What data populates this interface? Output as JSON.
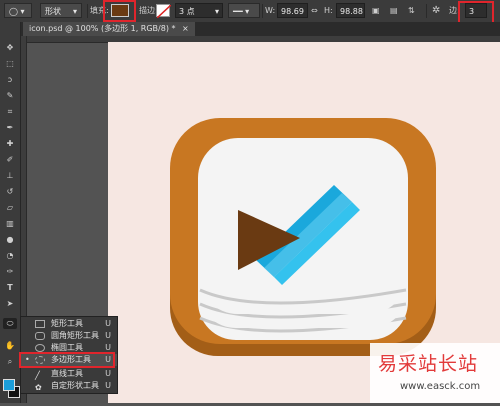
{
  "options": {
    "mode": "形状",
    "fill_label": "填充:",
    "stroke_label": "描边:",
    "stroke_width": "3 点",
    "w_label": "W:",
    "w_value": "98.69",
    "h_label": "H:",
    "h_value": "98.88",
    "sides_label": "边:",
    "sides_value": "3",
    "fill_color": "#6a3a12",
    "highlight_color": "#e0252c"
  },
  "document": {
    "tab_title": "icon.psd @ 100% (多边形 1, RGB/8) *"
  },
  "toolbar": {
    "tools": [
      "move-icon",
      "marquee-icon",
      "lasso-icon",
      "quick-select-icon",
      "crop-icon",
      "eyedropper-icon",
      "healing-icon",
      "brush-icon",
      "stamp-icon",
      "history-brush-icon",
      "eraser-icon",
      "gradient-icon",
      "blur-icon",
      "dodge-icon",
      "pen-icon",
      "type-icon",
      "path-select-icon",
      "shape-icon",
      "hand-icon",
      "zoom-icon"
    ],
    "foreground_color": "#1b9ed9",
    "background_color": "#111111"
  },
  "flyout": {
    "items": [
      {
        "label": "矩形工具",
        "key": "U"
      },
      {
        "label": "圆角矩形工具",
        "key": "U"
      },
      {
        "label": "椭圆工具",
        "key": "U"
      },
      {
        "label": "多边形工具",
        "key": "U"
      },
      {
        "label": "直线工具",
        "key": "U"
      },
      {
        "label": "自定形状工具",
        "key": "U"
      }
    ],
    "selected_index": 3
  },
  "icon_art": {
    "frame_color": "#c87722",
    "frame_shadow_color": "#a35e17",
    "card_color": "#f4f4f4",
    "card_edge_color": "#c9c9c9",
    "triangle_color": "#6a3a12",
    "stripe_colors": [
      "#1aa8dc",
      "#34c2ee",
      "#6fd6f5"
    ]
  },
  "watermark": {
    "cn": "易采站长站",
    "url": "www.easck.com"
  }
}
